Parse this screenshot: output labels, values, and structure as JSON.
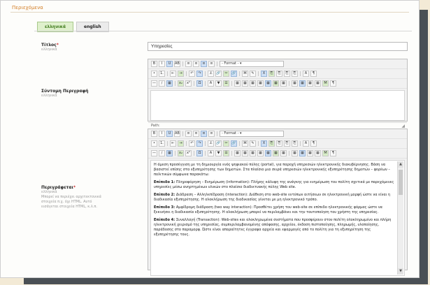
{
  "window": {
    "title": "Περιεχόμενα"
  },
  "tabs": [
    {
      "label": "ελληνικά",
      "active": true
    },
    {
      "label": "english",
      "active": false
    }
  ],
  "fields": {
    "title": {
      "label": "Τίτλος",
      "required": "*",
      "lang": "ελληνικά",
      "value": "Υπηρεσίες"
    },
    "summary": {
      "label": "Σύντομη Περιγραφή",
      "lang": "ελληνικά",
      "status": "Path:"
    },
    "description": {
      "label": "Περιγράφεται",
      "required": "*",
      "lang": "ελληνικά",
      "hint": "Μπορεί να περιέχει αρχιτεκτονικά στοιχεία π.χ. όχι HTML. Αυτό εισάγεται στοιχεία HTML, κ.λ.π.",
      "content": [
        {
          "bold": "",
          "text": "Η άμεση προσέγγιση με τη δημιουργία ενός ψηφιακού πύλης (portal), για παροχή υπηρεσιών ηλεκτρονικής διακυβέρνησης. Βάση να βασιστεί επίσης στα εξυπηρέτησης των δημοτών. Στα πλαίσιο μια σειρά υπηρεσιών ηλεκτρονικής εξυπηρέτησης δημοτών – φορέων – πολιτικών σύμφωνα παρακάτω:"
        },
        {
          "bold": "Επίπεδο 1:",
          "text": "Πληροφόρηση – Ενημέρωση (information): Πλήρης κάλυψη της ανάγκης για ενημέρωση του πολίτη σχετικά με παρεχόμενες υπηρεσίες μέσω ανηρτημένων υλικών στο πλαίσιο διαδικτυακής πύλης Web site."
        },
        {
          "bold": "Επίπεδο 2:",
          "text": "Διάδραση – Αλληλεπίδραση (interaction): Διάθεση στο web-site εντύπων αιτήσεων σε ηλεκτρονική μορφή ώστε να είναι η διαδικασία εξυπηρέτησης. Η ολοκλήρωση της διαδικασίας γίνεται με μη ηλεκτρονικό τρόπο."
        },
        {
          "bold": "Επίπεδο 3:",
          "text": "Αμφίδρομη διάδραση (two way interaction): Προσθέτει χρήση του web-site σε επίπεδο ηλεκτρονικής φόρμας ώστε να ξεκινήσει η διαδικασία εξυπηρέτησης. Η ολοκλήρωση μπορεί να περιλαμβάνει και την ταυτοποίηση του χρήστη της υπηρεσίας."
        },
        {
          "bold": "Επίπεδο 4:",
          "text": "Συναλλαγή (Transaction): Web-sites και ολοκληρωμένα συστήματα που προσφέρουν στον πολίτη ολοκληρωμένο και πλήρη ηλεκτρονική χειρισμό της υπηρεσίας, συμπεριλαμβανομένης απόφασης, αρχείου, έκδοση πιστοποίησης, πληρωμής, υλοποίησης, παράδοσης στο παραμορφ. Ώστε είναι απαραίτητες έγγραφα αρχεία και εφαρμογές από το πολίτη για τη εξυπηρέτηση της εξυπηρέτησης τους."
        }
      ]
    }
  },
  "editor": {
    "format_label": "- Format -",
    "toolbar_rows": [
      [
        "B",
        "I",
        "U",
        "ABC",
        "|",
        "≡",
        "≡",
        "≡",
        "≡",
        "|",
        "FORMAT"
      ],
      [
        "•",
        "1.",
        "|",
        "⇤",
        "⇥",
        "|",
        "↶",
        "↷",
        "|",
        "⚓",
        "🔗",
        "✂",
        "🔗",
        "|",
        "⌘",
        "✎",
        "|",
        "X",
        "⎘",
        "⎘",
        "⎘",
        "⎘",
        "|",
        "A",
        "¶"
      ],
      [
        "—",
        "∕",
        "▦",
        "|",
        "x₂",
        "x²",
        "|",
        "Ω",
        "|",
        "A",
        "▼",
        "☰",
        "|",
        "▦",
        "▦",
        "▦",
        "▦",
        "▦",
        "▦",
        "▦",
        "|",
        "▦",
        "▦",
        "▦",
        "▦",
        "M",
        "¶"
      ]
    ]
  },
  "colors": {
    "accent": "#d4802a",
    "tab_active_bg": "#dff0cc",
    "tab_active_text": "#3e7a1a"
  }
}
